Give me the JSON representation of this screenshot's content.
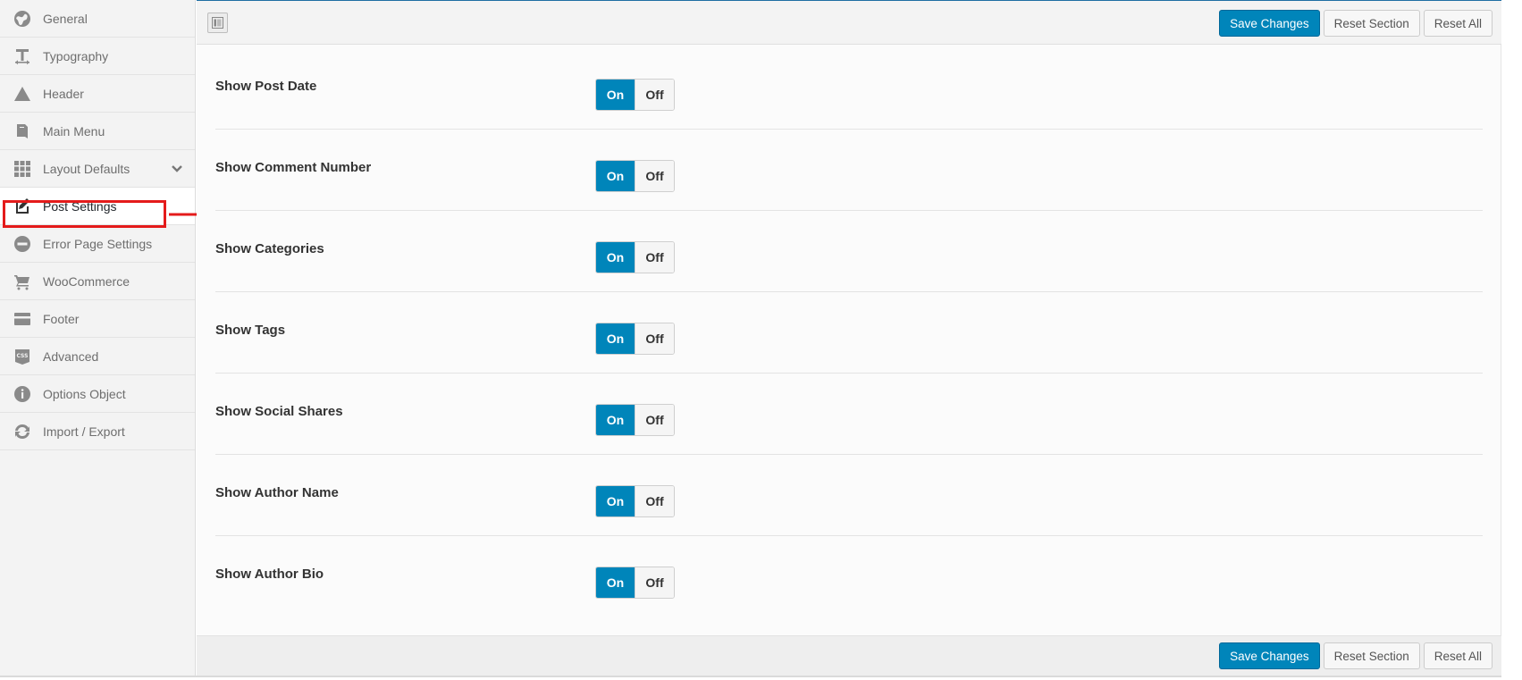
{
  "sidebar": {
    "items": [
      {
        "label": "General",
        "icon": "globe-icon"
      },
      {
        "label": "Typography",
        "icon": "text-icon"
      },
      {
        "label": "Header",
        "icon": "triangle-icon"
      },
      {
        "label": "Main Menu",
        "icon": "book-icon"
      },
      {
        "label": "Layout Defaults",
        "icon": "grid-icon"
      },
      {
        "label": "Post Settings",
        "icon": "edit-icon"
      },
      {
        "label": "Error Page Settings",
        "icon": "no-entry-icon"
      },
      {
        "label": "WooCommerce",
        "icon": "cart-icon"
      },
      {
        "label": "Footer",
        "icon": "card-icon"
      },
      {
        "label": "Advanced",
        "icon": "css-icon"
      },
      {
        "label": "Options Object",
        "icon": "info-icon"
      },
      {
        "label": "Import / Export",
        "icon": "refresh-icon"
      }
    ],
    "active_index": 5
  },
  "toolbar": {
    "save_label": "Save Changes",
    "reset_section_label": "Reset Section",
    "reset_all_label": "Reset All"
  },
  "settings": [
    {
      "label": "Show Post Date",
      "on_label": "On",
      "off_label": "Off",
      "value": "On"
    },
    {
      "label": "Show Comment Number",
      "on_label": "On",
      "off_label": "Off",
      "value": "On"
    },
    {
      "label": "Show Categories",
      "on_label": "On",
      "off_label": "Off",
      "value": "On"
    },
    {
      "label": "Show Tags",
      "on_label": "On",
      "off_label": "Off",
      "value": "On"
    },
    {
      "label": "Show Social Shares",
      "on_label": "On",
      "off_label": "Off",
      "value": "On"
    },
    {
      "label": "Show Author Name",
      "on_label": "On",
      "off_label": "Off",
      "value": "On"
    },
    {
      "label": "Show Author Bio",
      "on_label": "On",
      "off_label": "Off",
      "value": "On"
    }
  ],
  "colors": {
    "accent": "#0085ba",
    "highlight": "#e41b1b"
  }
}
